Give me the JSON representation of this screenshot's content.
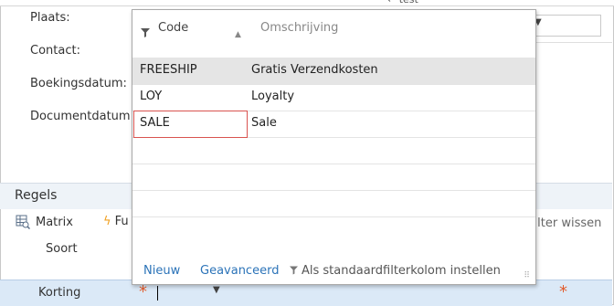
{
  "top_strip": {
    "glyph": "← test"
  },
  "form": {
    "labels": [
      "Plaats:",
      "Contact:",
      "Boekingsdatum:",
      "Documentdatum:"
    ]
  },
  "section": {
    "title": "Regels"
  },
  "toolbar": {
    "matrix_label": "Matrix",
    "functions_label": "Fu",
    "filter_clear_label": "Filter wissen"
  },
  "lines": {
    "column_header": "Soort",
    "row_label": "Korting",
    "required_marker": "*"
  },
  "popup": {
    "columns": {
      "code": "Code",
      "description": "Omschrijving"
    },
    "rows": [
      {
        "code": "FREESHIP",
        "description": "Gratis Verzendkosten",
        "selected": true
      },
      {
        "code": "LOY",
        "description": "Loyalty",
        "selected": false
      },
      {
        "code": "SALE",
        "description": "Sale",
        "selected": false,
        "highlighted": true
      }
    ],
    "footer": {
      "new_label": "Nieuw",
      "advanced_label": "Geavanceerd",
      "set_default_filter_label": "Als standaardfilterkolom instellen"
    }
  },
  "colors": {
    "accent_link": "#2b73b8",
    "required": "#e25b2c",
    "selected_row": "#e5e5e5",
    "highlight_border": "#d9534f"
  }
}
